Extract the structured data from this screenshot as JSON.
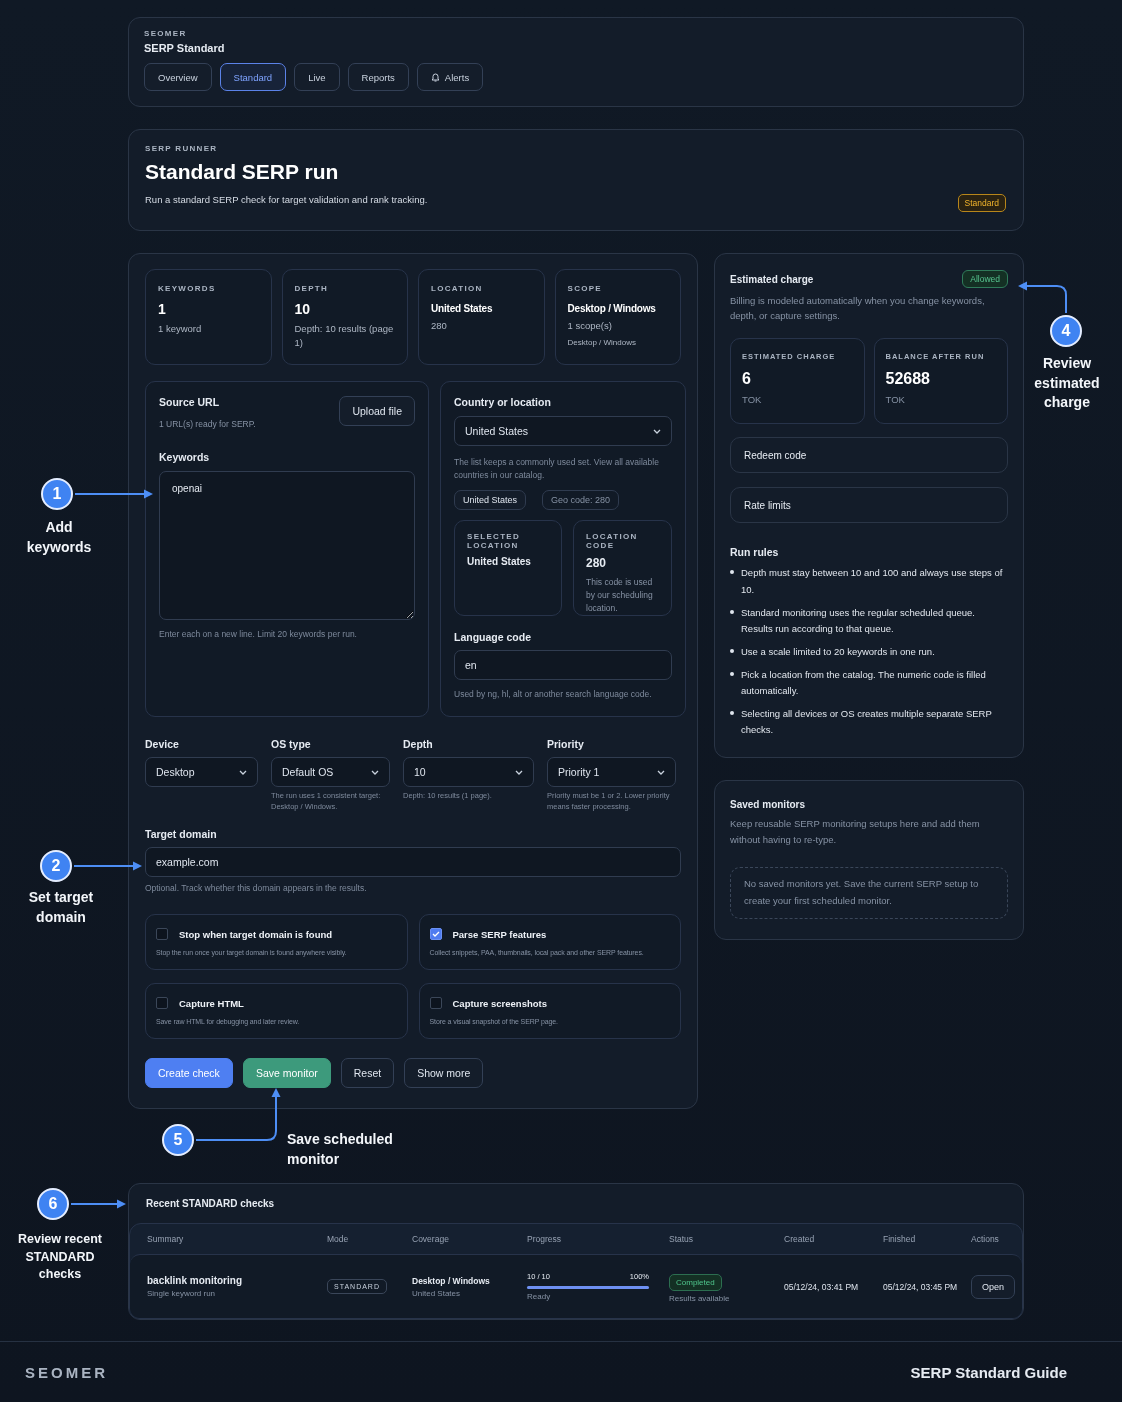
{
  "header": {
    "brand": "SEOMER",
    "title": "SERP Standard",
    "tabs": [
      {
        "label": "Overview",
        "selected": false,
        "kind": "text"
      },
      {
        "label": "Standard",
        "selected": true,
        "kind": "text"
      },
      {
        "label": "Live",
        "selected": false,
        "kind": "text"
      },
      {
        "label": "Reports",
        "selected": false,
        "kind": "text"
      },
      {
        "label": "Alerts",
        "selected": false,
        "kind": "bell"
      }
    ]
  },
  "hero": {
    "eyebrow": "SERP RUNNER",
    "title": "Standard SERP run",
    "description": "Run a standard SERP check for target validation and rank tracking.",
    "badge": "Standard"
  },
  "stats": [
    {
      "label": "KEYWORDS",
      "value": "1",
      "kind": "number",
      "note": "1 keyword"
    },
    {
      "label": "DEPTH",
      "value": "10",
      "kind": "number",
      "note": "Depth: 10 results (page 1)"
    },
    {
      "label": "LOCATION",
      "value": "United States",
      "kind": "text",
      "note": "280"
    },
    {
      "label": "SCOPE",
      "value": "Desktop / Windows",
      "kind": "text",
      "note": "1 scope(s)",
      "detail": "Desktop / Windows"
    }
  ],
  "source": {
    "label": "Source URL",
    "status": "1 URL(s) ready for SERP.",
    "upload_button": "Upload file",
    "keywords_label": "Keywords",
    "keywords_value": "openai",
    "keywords_hint": "Enter each on a new line. Limit 20 keywords per run."
  },
  "location": {
    "label": "Country or location",
    "select": "United States",
    "hint": "The list keeps a commonly used set. View all available countries in our catalog.",
    "chips": [
      {
        "text": "United States",
        "kind": "value"
      },
      {
        "text": "Geo code: 280",
        "kind": "code"
      }
    ],
    "selected_box": {
      "label": "SELECTED LOCATION",
      "value": "United States"
    },
    "code_box": {
      "label": "LOCATION CODE",
      "value": "280",
      "note": "This code is used by our scheduling location."
    },
    "language_label": "Language code",
    "language_value": "en",
    "language_hint": "Used by ng, hl, alt or another search language code."
  },
  "selects": [
    {
      "label": "Device",
      "value": "Desktop"
    },
    {
      "label": "OS type",
      "value": "Default OS",
      "hint": "The run uses 1 consistent target: Desktop / Windows."
    },
    {
      "label": "Depth",
      "value": "10",
      "hint": "Depth: 10 results (1 page)."
    },
    {
      "label": "Priority",
      "value": "Priority 1",
      "hint": "Priority must be 1 or 2. Lower priority means faster processing."
    }
  ],
  "target": {
    "label": "Target domain",
    "value": "example.com",
    "hint": "Optional. Track whether this domain appears in the results."
  },
  "options": [
    {
      "title": "Stop when target domain is found",
      "description": "Stop the run once your target domain is found anywhere visibly.",
      "checked": false
    },
    {
      "title": "Parse SERP features",
      "description": "Collect snippets, PAA, thumbnails, local pack and other SERP features.",
      "checked": true
    },
    {
      "title": "Capture HTML",
      "description": "Save raw HTML for debugging and later review.",
      "checked": false
    },
    {
      "title": "Capture screenshots",
      "description": "Store a visual snapshot of the SERP page.",
      "checked": false
    }
  ],
  "actions": [
    {
      "label": "Create check",
      "kind": "primary"
    },
    {
      "label": "Save monitor",
      "kind": "success"
    },
    {
      "label": "Reset",
      "kind": "secondary"
    },
    {
      "label": "Show more",
      "kind": "secondary"
    }
  ],
  "charge": {
    "title": "Estimated charge",
    "badge": "Allowed",
    "description": "Billing is modeled automatically when you change keywords, depth, or capture settings.",
    "metrics": [
      {
        "label": "ESTIMATED CHARGE",
        "value": "6",
        "unit": "TOK"
      },
      {
        "label": "BALANCE AFTER RUN",
        "value": "52688",
        "unit": "TOK"
      }
    ],
    "links": [
      "Redeem code",
      "Rate limits"
    ],
    "rules_title": "Run rules",
    "rules": [
      "Depth must stay between 10 and 100 and always use steps of 10.",
      "Standard monitoring uses the regular scheduled queue. Results run according to that queue.",
      "Use a scale limited to 20 keywords in one run.",
      "Pick a location from the catalog. The numeric code is filled automatically.",
      "Selecting all devices or OS creates multiple separate SERP checks."
    ]
  },
  "monitors": {
    "title": "Saved monitors",
    "description": "Keep reusable SERP monitoring setups here and add them without having to re-type.",
    "empty": "No saved monitors yet. Save the current SERP setup to create your first scheduled monitor."
  },
  "recent": {
    "title": "Recent STANDARD checks",
    "columns": [
      "Summary",
      "Mode",
      "Coverage",
      "Progress",
      "Status",
      "Created",
      "Finished",
      "Actions"
    ],
    "rows": [
      {
        "summary": "backlink monitoring",
        "summary_note": "Single keyword run",
        "mode": "STANDARD",
        "coverage": "Desktop / Windows",
        "coverage_note": "United States",
        "progress_count": "10 / 10",
        "progress_percent": "100%",
        "level": 1,
        "progress_note": "Ready",
        "status": "Completed",
        "status_note": "Results available",
        "created": "05/12/24, 03:41 PM",
        "finished": "05/12/24, 03:45 PM",
        "action": "Open"
      }
    ]
  },
  "annotations": [
    {
      "number": "1",
      "label": "Add keywords"
    },
    {
      "number": "2",
      "label": "Set target domain"
    },
    {
      "number": "4",
      "label": "Review estimated charge"
    },
    {
      "number": "5",
      "label": "Save scheduled monitor"
    },
    {
      "number": "6",
      "label": "Review recent STANDARD checks"
    }
  ],
  "footer": {
    "brand": "SEOMER",
    "guide": "SERP Standard Guide"
  }
}
